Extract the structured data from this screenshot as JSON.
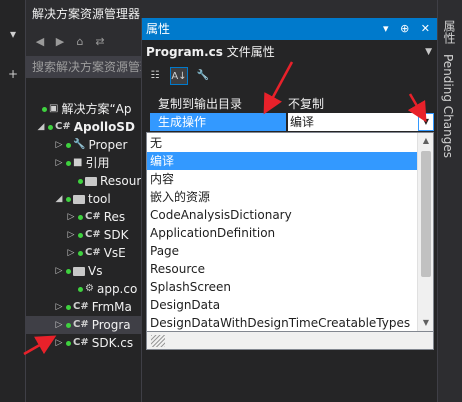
{
  "gutter": {
    "menu_glyph": "▾",
    "pin_glyph": "+"
  },
  "solution_explorer": {
    "title": "解决方案资源管理器",
    "search_placeholder": "搜索解决方案资源管理",
    "tree": [
      {
        "label": "解决方案“Ap",
        "kind": "solution"
      },
      {
        "label": "ApolloSD",
        "kind": "project",
        "bold": true
      },
      {
        "label": "Proper",
        "kind": "properties"
      },
      {
        "label": "引用",
        "kind": "references"
      },
      {
        "label": "Resour",
        "kind": "folder"
      },
      {
        "label": "tool",
        "kind": "folder"
      },
      {
        "label": "Res",
        "kind": "cs"
      },
      {
        "label": "SDK",
        "kind": "cs"
      },
      {
        "label": "VsE",
        "kind": "cs"
      },
      {
        "label": "Vs",
        "kind": "folder"
      },
      {
        "label": "app.co",
        "kind": "config"
      },
      {
        "label": "FrmMa",
        "kind": "cs"
      },
      {
        "label": "Progra",
        "kind": "cs",
        "selected": true
      },
      {
        "label": "SDK.cs",
        "kind": "cs"
      }
    ]
  },
  "properties": {
    "tab_title": "属性",
    "window_controls": "▾ ⊕ ✕",
    "object_name": "Program.cs",
    "object_type": "文件属性",
    "rows": [
      {
        "name": "复制到输出目录",
        "value": "不复制"
      },
      {
        "name": "生成操作",
        "value": "编译",
        "selected": true
      }
    ]
  },
  "dropdown": {
    "items": [
      {
        "label": "无"
      },
      {
        "label": "编译",
        "selected": true
      },
      {
        "label": "内容"
      },
      {
        "label": "嵌入的资源"
      },
      {
        "label": "CodeAnalysisDictionary"
      },
      {
        "label": "ApplicationDefinition"
      },
      {
        "label": "Page"
      },
      {
        "label": "Resource"
      },
      {
        "label": "SplashScreen"
      },
      {
        "label": "DesignData"
      },
      {
        "label": "DesignDataWithDesignTimeCreatableTypes"
      }
    ]
  },
  "right_bar": {
    "tabs": [
      "属性",
      "Pending Changes"
    ]
  },
  "annotation_color": "#e8212a"
}
